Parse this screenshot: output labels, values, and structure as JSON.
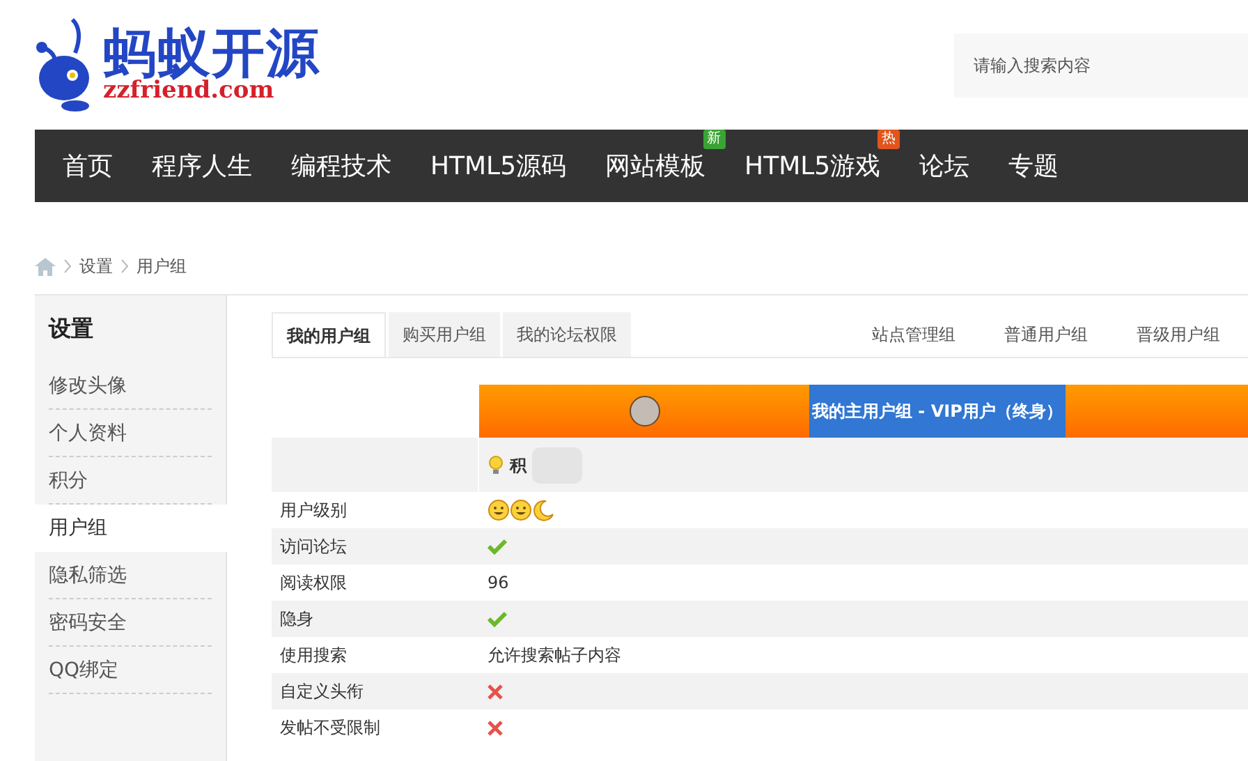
{
  "logo": {
    "title": "蚂蚁开源",
    "domain": "zzfriend.com"
  },
  "search": {
    "placeholder": "请输入搜索内容"
  },
  "nav": [
    {
      "label": "首页"
    },
    {
      "label": "程序人生"
    },
    {
      "label": "编程技术"
    },
    {
      "label": "HTML5源码"
    },
    {
      "label": "网站模板",
      "badge": {
        "text": "新",
        "color": "#3aa335"
      }
    },
    {
      "label": "HTML5游戏",
      "badge": {
        "text": "热",
        "color": "#e2541b"
      }
    },
    {
      "label": "论坛"
    },
    {
      "label": "专题"
    }
  ],
  "breadcrumb": [
    "设置",
    "用户组"
  ],
  "sidebar": {
    "title": "设置",
    "items": [
      {
        "label": "修改头像",
        "selected": false
      },
      {
        "label": "个人资料",
        "selected": false
      },
      {
        "label": "积分",
        "selected": false
      },
      {
        "label": "用户组",
        "selected": true
      },
      {
        "label": "隐私筛选",
        "selected": false
      },
      {
        "label": "密码安全",
        "selected": false
      },
      {
        "label": "QQ绑定",
        "selected": false
      }
    ]
  },
  "tabs": [
    {
      "label": "我的用户组",
      "selected": true
    },
    {
      "label": "购买用户组",
      "selected": false
    },
    {
      "label": "我的论坛权限",
      "selected": false
    }
  ],
  "group_links": [
    "站点管理组",
    "普通用户组",
    "晋级用户组"
  ],
  "group_banner": {
    "label": "我的主用户组 - VIP用户（终身）"
  },
  "points": {
    "label": "积"
  },
  "rows": [
    {
      "label": "用户级别",
      "kind": "level-icons"
    },
    {
      "label": "访问论坛",
      "kind": "check"
    },
    {
      "label": "阅读权限",
      "kind": "text",
      "value": "96"
    },
    {
      "label": "隐身",
      "kind": "check"
    },
    {
      "label": "使用搜索",
      "kind": "text",
      "value": "允许搜索帖子内容"
    },
    {
      "label": "自定义头衔",
      "kind": "cross"
    },
    {
      "label": "发帖不受限制",
      "kind": "cross"
    }
  ]
}
